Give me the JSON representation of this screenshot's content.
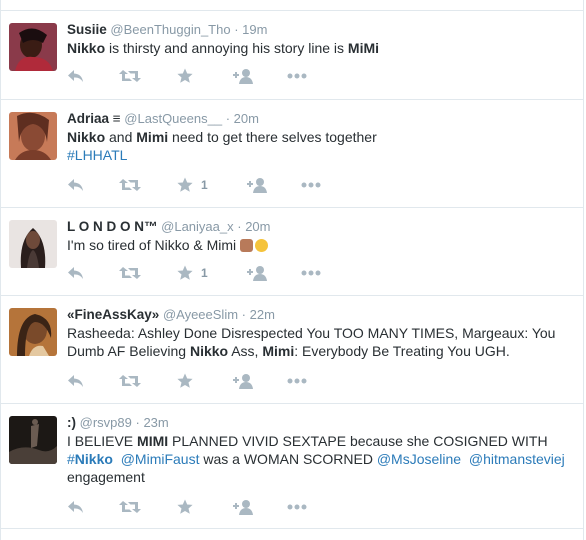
{
  "tweets": [
    {
      "name": "Susiie",
      "handle": "@BeenThuggin_Tho",
      "time": "19m",
      "line1": {
        "b1": "Nikko",
        "t1": " is thirsty and annoying his story line is ",
        "b2": "MiMi"
      },
      "fav_count": "",
      "colors": {
        "bg": "#8a3a4a",
        "fg": "#1a0d0f"
      }
    },
    {
      "name": "Adriaa",
      "name_suffix": " ≡",
      "handle": "@LastQueens__",
      "time": "20m",
      "line1": {
        "b1": "Nikko",
        "t1": " and ",
        "b2": "Mimi",
        "t2": " need to get there selves together"
      },
      "hashtag": "#LHHATL",
      "fav_count": "1",
      "colors": {
        "bg": "#c77a58",
        "fg": "#5e2e20"
      }
    },
    {
      "name": "L O N D O N™",
      "handle": "@Laniyaa_x",
      "time": "20m",
      "text": "I'm so tired of Nikko & Mimi ",
      "fav_count": "1",
      "colors": {
        "bg": "#e9e4e2",
        "fg": "#2a1e1c"
      }
    },
    {
      "name": "«FineAssKay»",
      "handle": "@AyeeeSlim",
      "time": "22m",
      "seg": {
        "a": "Rasheeda: Ashley Done Disrespected You TOO MANY TIMES, Margeaux: You",
        "b": "Dumb AF Believing ",
        "c": "Nikko",
        "d": " Ass, ",
        "e": "Mimi",
        "f": ": Everybody Be Treating You UGH."
      },
      "fav_count": "",
      "colors": {
        "bg": "#b5743a",
        "fg": "#3b2416"
      }
    },
    {
      "name": ":)",
      "handle": "@rsvp89",
      "time": "23m",
      "seg": {
        "a": "I BELIEVE ",
        "b": "MIMI",
        "c": " PLANNED VIVID SEXTAPE because she COSIGNED WITH",
        "h1": "#Nikko",
        "m1": "@MimiFaust",
        "t1": " was a WOMAN SCORNED ",
        "m2": "@MsJoseline",
        "m3": "@hitmansteviej",
        "e": "engagement"
      },
      "fav_count": "",
      "colors": {
        "bg": "#1c1815",
        "fg": "#6b5c52"
      }
    }
  ],
  "icons": [
    "reply-icon",
    "retweet-icon",
    "favorite-icon",
    "follow-icon",
    "more-icon"
  ],
  "colors": {
    "link": "#2b7bb9",
    "muted": "#8899a6",
    "icon": "#aab8c2",
    "border": "#e1e8ed"
  }
}
